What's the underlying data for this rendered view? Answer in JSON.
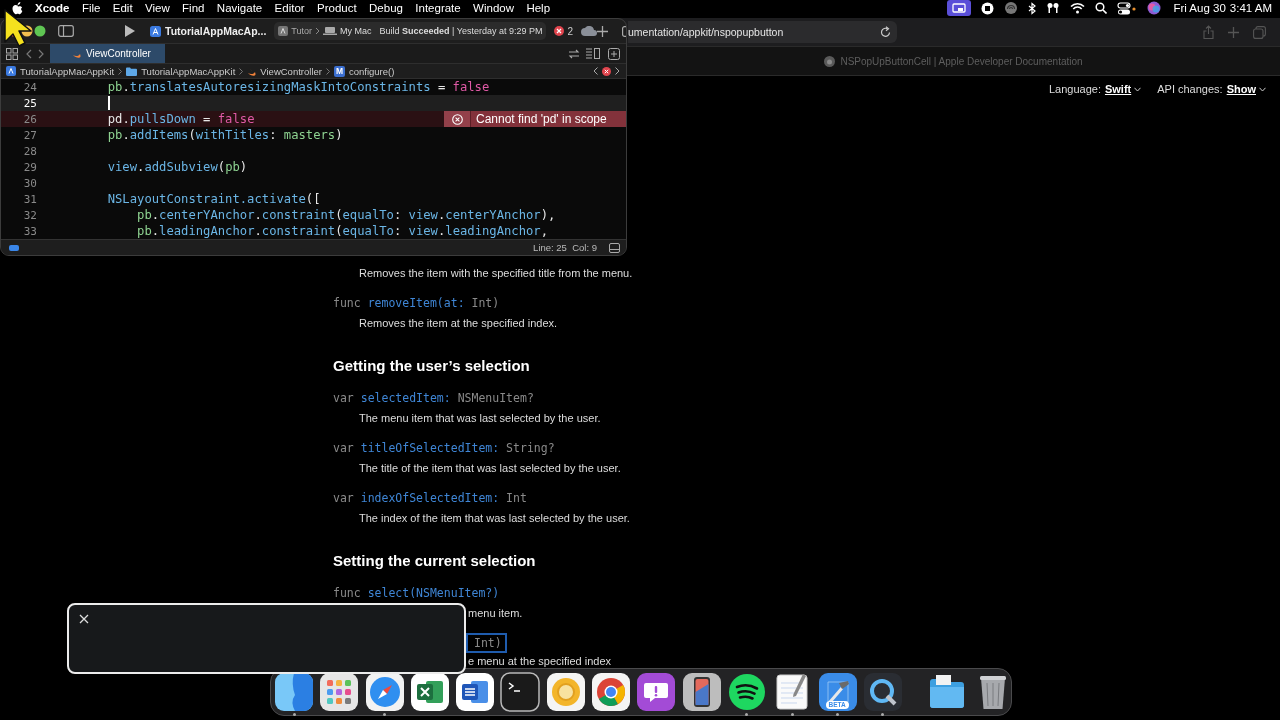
{
  "menubar": {
    "menus": [
      {
        "label": "Xcode",
        "kind": "app"
      },
      {
        "label": "File",
        "kind": "menu"
      },
      {
        "label": "Edit",
        "kind": "menu"
      },
      {
        "label": "View",
        "kind": "menu"
      },
      {
        "label": "Find",
        "kind": "menu"
      },
      {
        "label": "Navigate",
        "kind": "menu"
      },
      {
        "label": "Editor",
        "kind": "menu"
      },
      {
        "label": "Product",
        "kind": "menu"
      },
      {
        "label": "Debug",
        "kind": "menu"
      },
      {
        "label": "Integrate",
        "kind": "menu"
      },
      {
        "label": "Window",
        "kind": "menu"
      },
      {
        "label": "Help",
        "kind": "menu"
      }
    ],
    "date": "Fri Aug 30",
    "time": "3:41 AM"
  },
  "xcode": {
    "scheme": "TutorialAppMacAp...",
    "destination_target": "Tutor",
    "destination_device": "My Mac",
    "build_status": "Build **Succeeded** | Yesterday at 9:29 PM",
    "error_count": "2",
    "tabs": [
      {
        "label": "ViewController",
        "selected": true
      }
    ],
    "breadcrumbs": [
      {
        "label": "TutorialAppMacAppKit",
        "kind": "project"
      },
      {
        "label": "TutorialAppMacAppKit",
        "kind": "folder"
      },
      {
        "label": "ViewController",
        "kind": "swift"
      },
      {
        "label": "configure()",
        "kind": "method",
        "symbol": "M"
      }
    ],
    "lines": [
      {
        "number": "24",
        "current": false,
        "tokens": [
          {
            "kind": "local",
            "text": "        pb"
          },
          {
            "kind": "plain",
            "text": "."
          },
          {
            "kind": "api",
            "text": "translatesAutoresizingMaskIntoConstraints"
          },
          {
            "kind": "plain",
            "text": " = "
          },
          {
            "kind": "keyword",
            "text": "false"
          }
        ]
      },
      {
        "number": "25",
        "current": true
      },
      {
        "number": "26",
        "current": false,
        "error": "Cannot find 'pd' in scope",
        "tokens": [
          {
            "kind": "plain",
            "text": "        pd"
          },
          {
            "kind": "plain",
            "text": "."
          },
          {
            "kind": "api",
            "text": "pullsDown"
          },
          {
            "kind": "plain",
            "text": " = "
          },
          {
            "kind": "keyword",
            "text": "false"
          }
        ]
      },
      {
        "number": "27",
        "current": false,
        "tokens": [
          {
            "kind": "local",
            "text": "        pb"
          },
          {
            "kind": "plain",
            "text": "."
          },
          {
            "kind": "api",
            "text": "addItems"
          },
          {
            "kind": "plain",
            "text": "("
          },
          {
            "kind": "api",
            "text": "withTitles"
          },
          {
            "kind": "plain",
            "text": ": "
          },
          {
            "kind": "local",
            "text": "masters"
          },
          {
            "kind": "plain",
            "text": ")"
          }
        ]
      },
      {
        "number": "28",
        "current": false
      },
      {
        "number": "29",
        "current": false,
        "tokens": [
          {
            "kind": "api",
            "text": "        view"
          },
          {
            "kind": "plain",
            "text": "."
          },
          {
            "kind": "api",
            "text": "addSubview"
          },
          {
            "kind": "plain",
            "text": "("
          },
          {
            "kind": "local",
            "text": "pb"
          },
          {
            "kind": "plain",
            "text": ")"
          }
        ]
      },
      {
        "number": "30",
        "current": false
      },
      {
        "number": "31",
        "current": false,
        "tokens": [
          {
            "kind": "api",
            "text": "        NSLayoutConstraint"
          },
          {
            "kind": "api",
            "text": ".activate"
          },
          {
            "kind": "plain",
            "text": "(["
          }
        ]
      },
      {
        "number": "32",
        "current": false,
        "tokens": [
          {
            "kind": "local",
            "text": "            pb"
          },
          {
            "kind": "plain",
            "text": "."
          },
          {
            "kind": "api",
            "text": "centerYAnchor"
          },
          {
            "kind": "plain",
            "text": "."
          },
          {
            "kind": "api",
            "text": "constraint"
          },
          {
            "kind": "plain",
            "text": "("
          },
          {
            "kind": "api",
            "text": "equalTo"
          },
          {
            "kind": "plain",
            "text": ": "
          },
          {
            "kind": "api",
            "text": "view"
          },
          {
            "kind": "plain",
            "text": "."
          },
          {
            "kind": "api",
            "text": "centerYAnchor"
          },
          {
            "kind": "plain",
            "text": "),"
          }
        ]
      },
      {
        "number": "33",
        "current": false,
        "tokens": [
          {
            "kind": "local",
            "text": "            pb"
          },
          {
            "kind": "plain",
            "text": "."
          },
          {
            "kind": "api",
            "text": "leadingAnchor"
          },
          {
            "kind": "plain",
            "text": "."
          },
          {
            "kind": "api",
            "text": "constraint"
          },
          {
            "kind": "plain",
            "text": "("
          },
          {
            "kind": "api",
            "text": "equalTo"
          },
          {
            "kind": "plain",
            "text": ": "
          },
          {
            "kind": "api",
            "text": "view"
          },
          {
            "kind": "plain",
            "text": "."
          },
          {
            "kind": "api",
            "text": "leadingAnchor"
          },
          {
            "kind": "plain",
            "text": ","
          }
        ]
      }
    ],
    "cursor_position": "Line: 25  Col: 9"
  },
  "safari": {
    "url": "umentation/appkit/nspopupbutton",
    "tab_title": "NSPopUpButtonCell | Apple Developer Documentation",
    "language_label": "Language:",
    "language": "Swift",
    "api_label": "API changes:",
    "api_value": "Show",
    "doc": [
      {
        "kind": "desc",
        "text": "Removes the item with the specified title from the menu."
      },
      {
        "kind": "sig",
        "keyword": "func",
        "name": "removeItem(at:",
        "rest": "Int)"
      },
      {
        "kind": "desc",
        "text": "Removes the item at the specified index."
      },
      {
        "kind": "heading",
        "text": "Getting the user’s selection"
      },
      {
        "kind": "sig",
        "keyword": "var",
        "name": "selectedItem:",
        "rest": "NSMenuItem?"
      },
      {
        "kind": "desc",
        "text": "The menu item that was last selected by the user."
      },
      {
        "kind": "sig",
        "keyword": "var",
        "name": "titleOfSelectedItem:",
        "rest": "String?"
      },
      {
        "kind": "desc",
        "text": "The title of the item that was last selected by the user."
      },
      {
        "kind": "sig",
        "keyword": "var",
        "name": "indexOfSelectedItem:",
        "rest": "Int"
      },
      {
        "kind": "desc",
        "text": "The index of the item that was last selected by the user."
      },
      {
        "kind": "heading",
        "text": "Setting the current selection"
      },
      {
        "kind": "sig",
        "keyword": "func",
        "name": "select(NSMenuItem?)"
      },
      {
        "kind": "desc_partial",
        "text": "menu item."
      },
      {
        "kind": "sig_partial",
        "rest": "Int)"
      },
      {
        "kind": "desc_partial",
        "text": "e menu at the specified index"
      }
    ]
  },
  "dock": {
    "apps": [
      {
        "kind": "finder",
        "running": true
      },
      {
        "kind": "launchpad",
        "running": false
      },
      {
        "kind": "safari",
        "running": true
      },
      {
        "kind": "excel",
        "running": false
      },
      {
        "kind": "word",
        "running": false
      },
      {
        "kind": "terminal",
        "running": false
      },
      {
        "kind": "ring",
        "running": false
      },
      {
        "kind": "chrome",
        "running": false
      },
      {
        "kind": "feedback",
        "running": false
      },
      {
        "kind": "simulator",
        "running": false
      },
      {
        "kind": "spotify",
        "running": true
      },
      {
        "kind": "textedit",
        "running": true
      },
      {
        "kind": "xcode",
        "running": true,
        "badge": "BETA"
      },
      {
        "kind": "quicktime",
        "running": true
      }
    ],
    "others": [
      {
        "kind": "folder",
        "running": false
      },
      {
        "kind": "trash",
        "running": false
      }
    ]
  }
}
